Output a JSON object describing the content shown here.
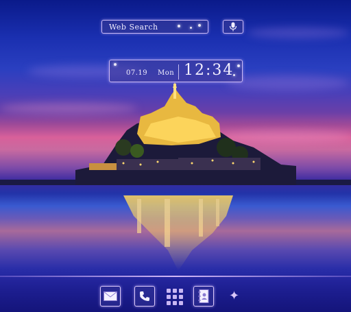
{
  "search": {
    "label": "Web Search"
  },
  "clock": {
    "date": "07.19",
    "day": "Mon",
    "time": "12:34"
  },
  "dock": {
    "items": [
      {
        "name": "mail-icon"
      },
      {
        "name": "phone-icon"
      },
      {
        "name": "app-drawer-icon"
      },
      {
        "name": "contacts-icon"
      },
      {
        "name": "sparkle-star-icon"
      }
    ]
  },
  "colors": {
    "frame": "#dcc8ff",
    "sky_top": "#0a1a8a",
    "sunset": "#d8609a",
    "castle_light": "#ffd860"
  }
}
